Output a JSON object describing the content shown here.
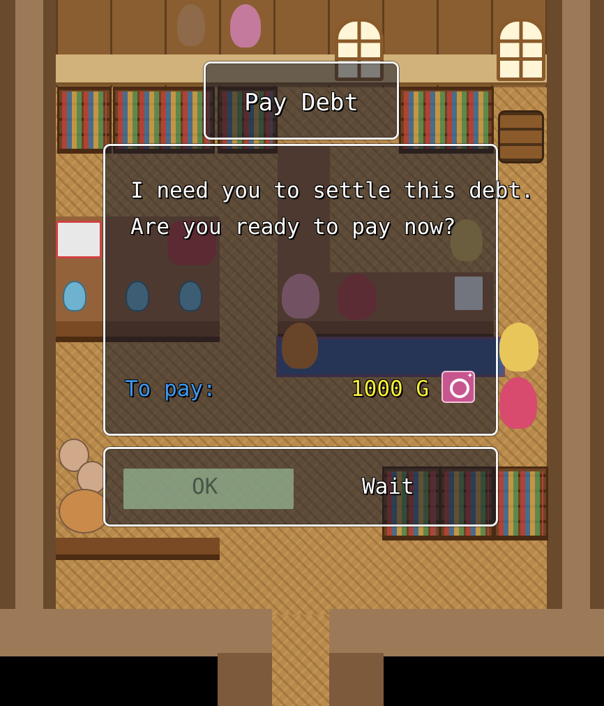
{
  "title_window": {
    "label": "Pay Debt"
  },
  "message": {
    "line1": "I need you to settle this debt.",
    "line2": "Are you ready to pay now?"
  },
  "payment": {
    "label": "To pay:",
    "amount": "1000 G",
    "currency_icon": "gold-coin-icon",
    "label_color": "#3f9bf5",
    "amount_color": "#fff23a"
  },
  "choices": {
    "ok": "OK",
    "wait": "Wait",
    "selected": "ok"
  }
}
